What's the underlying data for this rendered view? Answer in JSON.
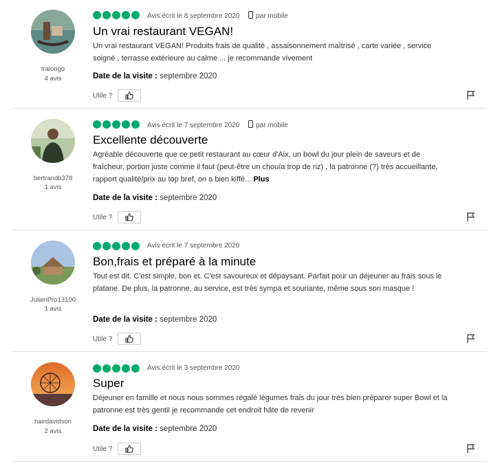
{
  "reviews": [
    {
      "username": "tralongo",
      "review_count": "4 avis",
      "rating": 5,
      "date": "Avis écrit le 8 septembre 2020",
      "mobile": "par mobile",
      "title": "Un vrai restaurant VEGAN!",
      "body": "Un vrai restaurant VEGAN! Produits frais de qualité , assaisonnement maîtrisé , carte variée , service soigné , terrasse extérieure au calme ... je recommande vivement",
      "more": "",
      "visit_label": "Date de la visite :",
      "visit_date": "septembre 2020",
      "useful_label": "Utile ?"
    },
    {
      "username": "bertrandb378",
      "review_count": "1 avis",
      "rating": 5,
      "date": "Avis écrit le 7 septembre 2020",
      "mobile": "par mobile",
      "title": "Excellente découverte",
      "body": "Agréable découverte que ce petit restaurant au cœur d'Aix, un bowl du jour plein de saveurs et de fraîcheur, portion juste comme il faut (peut-être un chouïa trop de riz) , la patronne (?) très accueillante, rapport qualité/prix au top bref, on a bien kiffé...",
      "more": "Plus",
      "visit_label": "Date de la visite :",
      "visit_date": "septembre 2020",
      "useful_label": "Utile ?"
    },
    {
      "username": "JulienPro13100",
      "review_count": "1 avis",
      "rating": 5,
      "date": "Avis écrit le 7 septembre 2020",
      "mobile": "",
      "title": "Bon,frais et préparé à la minute",
      "body": "Tout est dit. C'est simple, bon et. C'est savoureux et dépaysant. Parfait pour un déjeuner au frais sous le platane. De plus, la patronne, au service, est très sympa et souriante, même sous son masque !",
      "more": "",
      "visit_label": "Date de la visite :",
      "visit_date": "septembre 2020",
      "useful_label": "Utile ?"
    },
    {
      "username": "hairdavidson",
      "review_count": "2 avis",
      "rating": 5,
      "date": "Avis écrit le 3 septembre 2020",
      "mobile": "",
      "title": "Super",
      "body": "Déjeuner en famille et nous nous sommes régalé légumes frais du jour très bien préparer super Bowl et la patronne est très gentil je recommande cet endroit hâte de revenir",
      "more": "",
      "visit_label": "Date de la visite :",
      "visit_date": "septembre 2020",
      "useful_label": "Utile ?"
    }
  ]
}
